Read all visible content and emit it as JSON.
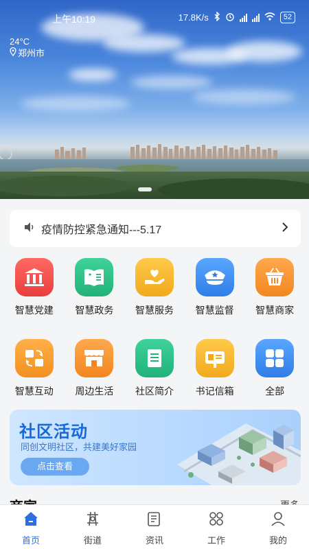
{
  "status_bar": {
    "time": "上午10:19",
    "speed": "17.8K/s",
    "battery": "52"
  },
  "weather": {
    "temperature": "24°C",
    "city": "郑州市"
  },
  "notice": {
    "text": "疫情防控紧急通知---5.17"
  },
  "services": [
    {
      "label": "智慧党建",
      "icon": "party-building-icon",
      "color": "#ee4b4b"
    },
    {
      "label": "智慧政务",
      "icon": "government-book-icon",
      "color": "#2fbf86"
    },
    {
      "label": "智慧服务",
      "icon": "heart-hand-icon",
      "color": "#f4b125"
    },
    {
      "label": "智慧监督",
      "icon": "police-cap-icon",
      "color": "#3d8ff0"
    },
    {
      "label": "智慧商家",
      "icon": "shopping-basket-icon",
      "color": "#f5902d"
    },
    {
      "label": "智慧互动",
      "icon": "interaction-icon",
      "color": "#f29a2e"
    },
    {
      "label": "周边生活",
      "icon": "store-icon",
      "color": "#f5902d"
    },
    {
      "label": "社区简介",
      "icon": "document-icon",
      "color": "#27bf8a"
    },
    {
      "label": "书记信箱",
      "icon": "mailbox-icon",
      "color": "#f4b125"
    },
    {
      "label": "全部",
      "icon": "all-apps-icon",
      "color": "#3d8ff0"
    }
  ],
  "banner": {
    "title": "社区活动",
    "subtitle": "同创文明社区，共建美好家园",
    "button": "点击查看"
  },
  "section": {
    "title": "商家",
    "more": "更多"
  },
  "tabs": [
    {
      "label": "首页",
      "icon": "home-icon",
      "active": true
    },
    {
      "label": "街道",
      "icon": "street-icon",
      "active": false
    },
    {
      "label": "资讯",
      "icon": "news-icon",
      "active": false
    },
    {
      "label": "工作",
      "icon": "work-icon",
      "active": false
    },
    {
      "label": "我的",
      "icon": "profile-icon",
      "active": false
    }
  ],
  "colors": {
    "accent": "#2f6fe0",
    "banner_title": "#1869d8"
  }
}
